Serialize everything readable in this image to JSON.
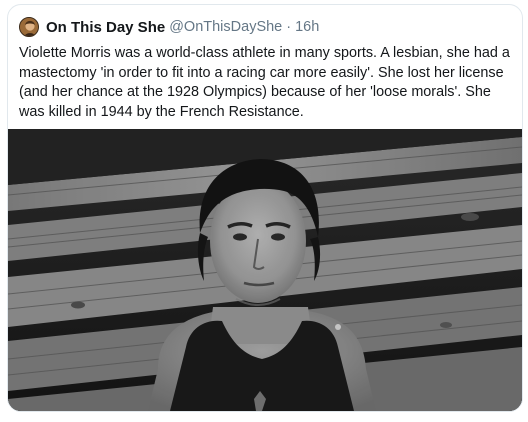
{
  "tweet": {
    "author_name": "On This Day She",
    "author_handle": "@OnThisDayShe",
    "separator": "·",
    "timestamp": "16h",
    "text": "Violette Morris was a world-class athlete in many sports. A lesbian, she had a mastectomy 'in order to fit into a racing car more easily'. She lost her license (and her chance at the 1928 Olympics) because of her 'loose morals'. She was killed in 1944 by the French Resistance."
  },
  "media": {
    "kind": "black-and-white photograph",
    "subject": "woman with short dark hair wearing a sleeveless dark athletic top, standing in front of weathered wooden planks"
  },
  "colors": {
    "text": "#14171a",
    "secondary": "#657786",
    "border": "#e1e8ed"
  },
  "icons": {
    "avatar": "avatar-portrait-icon"
  }
}
